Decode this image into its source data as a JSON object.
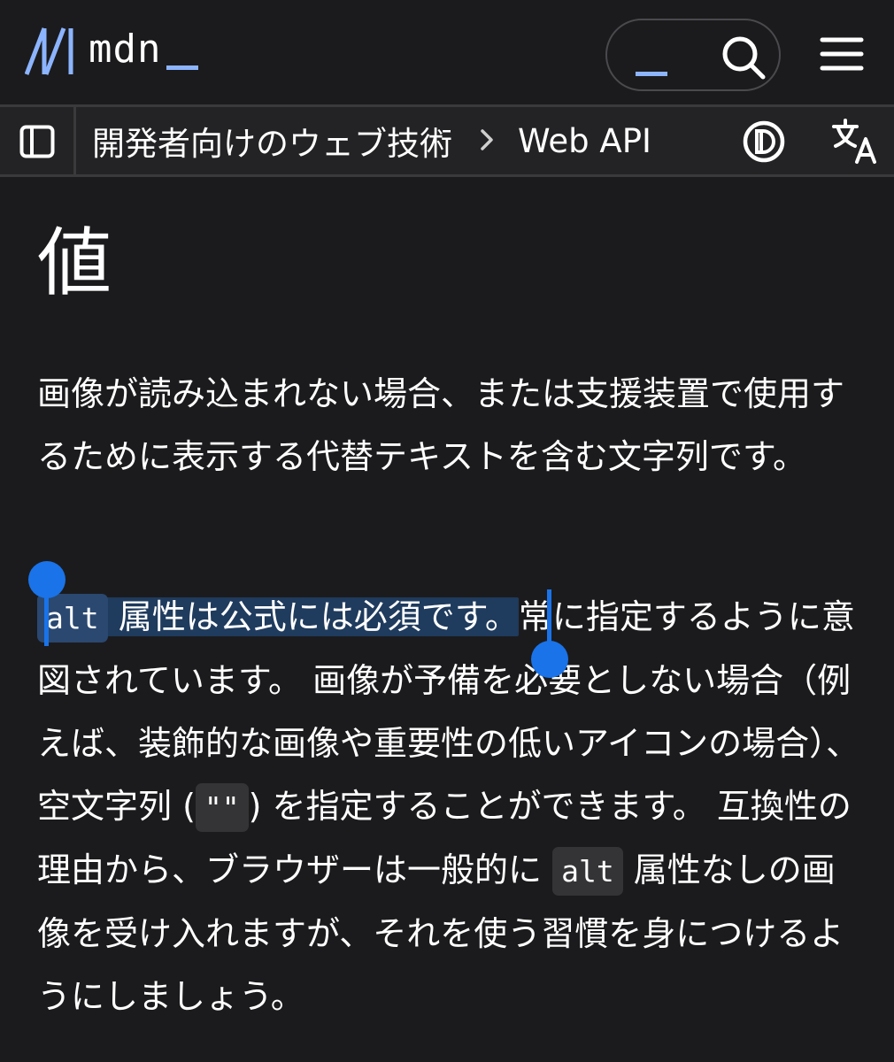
{
  "header": {
    "logo_text": "mdn"
  },
  "breadcrumb": {
    "items": [
      "開発者向けのウェブ技術",
      "Web API"
    ]
  },
  "page": {
    "title": "値",
    "para1": "画像が読み込まれない場合、または支援装置で使用するために表示する代替テキストを含む文字列です。",
    "para2_selected_code": "alt",
    "para2_selected_text": " 属性は公式には必須です。",
    "para2_after_selection": "常に指定するように意図されています。 画像が予備を必要としない場合（例えば、装飾的な画像や重要性の低いアイコンの場合）、空文字列 (",
    "para2_empty_string_code": "\"\"",
    "para2_after_empty": ") を指定することができます。 互換性の理由から、ブラウザーは一般的に ",
    "para2_code_alt": "alt",
    "para2_end": " 属性なしの画像を受け入れますが、それを使う習慣を身につけるようにしましょう。"
  },
  "icons": {
    "logo": "mdn-logo-icon",
    "search": "search-icon",
    "menu": "hamburger-menu-icon",
    "sidebar": "sidebar-toggle-icon",
    "chevron": "chevron-right-icon",
    "theme": "theme-toggle-icon",
    "translate": "translate-icon"
  },
  "colors": {
    "background": "#1b1b1d",
    "accent": "#8cb4ff",
    "selection_handle": "#1a73e8",
    "selection_bg": "#1f3b5d"
  }
}
